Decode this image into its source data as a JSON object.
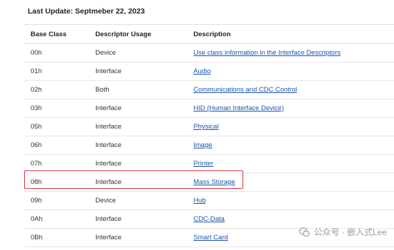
{
  "header": {
    "last_update": "Last Update: Septmeber 22, 2023"
  },
  "table": {
    "columns": [
      "Base Class",
      "Descriptor Usage",
      "Description"
    ],
    "rows": [
      {
        "base_class": "00h",
        "usage": "Device",
        "description": "Use class information in the Interface Descriptors"
      },
      {
        "base_class": "01h",
        "usage": "Interface",
        "description": "Audio"
      },
      {
        "base_class": "02h",
        "usage": "Both",
        "description": "Communications and CDC Control"
      },
      {
        "base_class": "03h",
        "usage": "Interface",
        "description": "HID (Human Interface Device)"
      },
      {
        "base_class": "05h",
        "usage": "Interface",
        "description": "Physical"
      },
      {
        "base_class": "06h",
        "usage": "Interface",
        "description": "Image"
      },
      {
        "base_class": "07h",
        "usage": "Interface",
        "description": "Printer"
      },
      {
        "base_class": "08h",
        "usage": "Interface",
        "description": "Mass Storage"
      },
      {
        "base_class": "09h",
        "usage": "Device",
        "description": "Hub"
      },
      {
        "base_class": "0Ah",
        "usage": "Interface",
        "description": "CDC-Data"
      },
      {
        "base_class": "0Bh",
        "usage": "Interface",
        "description": "Smart Card"
      }
    ]
  },
  "highlight": {
    "row_base_class": "08h",
    "color": "#d9363e"
  },
  "colors": {
    "link": "#1a55a8",
    "text": "#222222",
    "border": "#e2e2e2"
  },
  "watermark": {
    "text": "公众号 · 嵌入式Lee",
    "icon": "wechat-icon"
  }
}
